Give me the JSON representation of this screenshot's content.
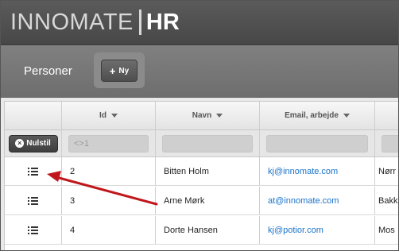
{
  "app": {
    "logo_main": "INNOMATE",
    "logo_suffix": "HR"
  },
  "toolbar": {
    "title": "Personer",
    "new_label": "Ny"
  },
  "grid": {
    "columns": [
      "Id",
      "Navn",
      "Email, arbejde"
    ],
    "filters": {
      "reset_label": "Nulstil",
      "id_value": "<>1"
    },
    "rows": [
      {
        "id": "2",
        "name": "Bitten Holm",
        "email": "kj@innomate.com",
        "extra": "Nørr"
      },
      {
        "id": "3",
        "name": "Arne Mørk",
        "email": "at@innomate.com",
        "extra": "Bakk"
      },
      {
        "id": "4",
        "name": "Dorte Hansen",
        "email": "kj@potior.com",
        "extra": "Mos"
      }
    ]
  },
  "annotation": {
    "color": "#c0171c"
  }
}
